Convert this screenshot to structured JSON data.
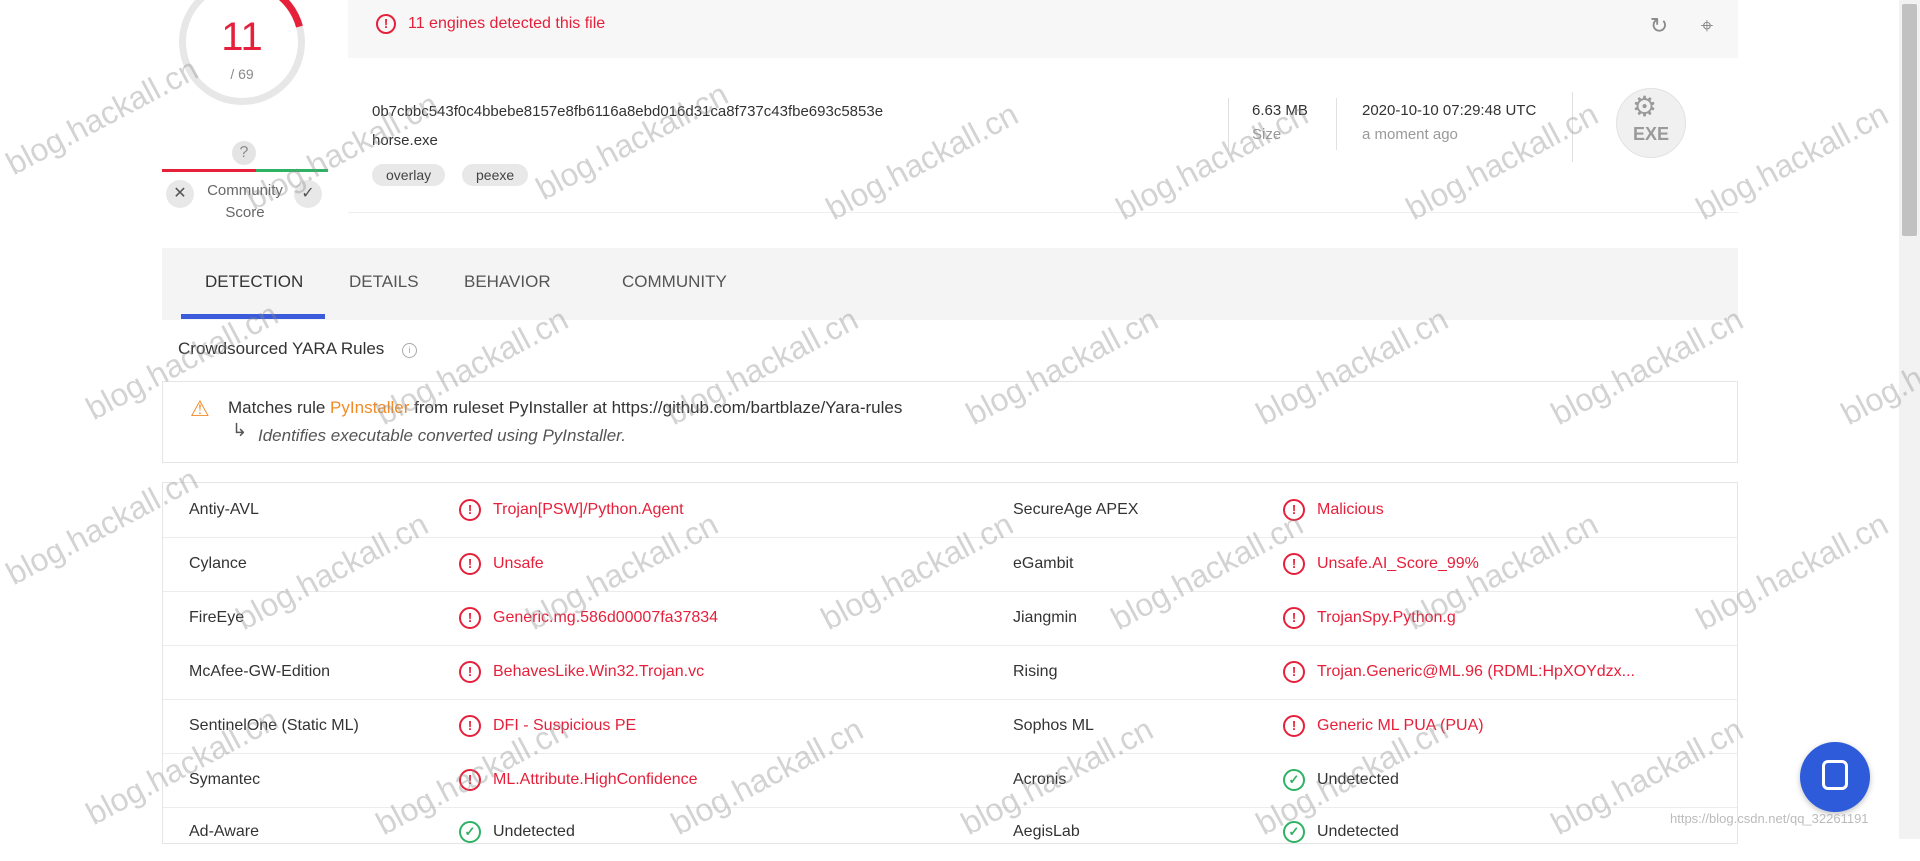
{
  "banner": {
    "text": "11 engines detected this file"
  },
  "score": {
    "detected": "11",
    "total": "/ 69",
    "unknown_badge": "?",
    "community_label": "Community Score"
  },
  "file": {
    "hash": "0b7cbbc543f0c4bbebe8157e8fb6116a8ebd016d31ca8f737c43fbe693c5853e",
    "name": "horse.exe",
    "tags": [
      "overlay",
      "peexe"
    ],
    "size_value": "6.63 MB",
    "size_label": "Size",
    "date_value": "2020-10-10 07:29:48 UTC",
    "date_label": "a moment ago",
    "type_icon_text": "EXE"
  },
  "tabs": [
    "DETECTION",
    "DETAILS",
    "BEHAVIOR",
    "COMMUNITY"
  ],
  "yara": {
    "title": "Crowdsourced YARA Rules",
    "prefix": "Matches rule ",
    "rule": "PyInstaller",
    "suffix": " from ruleset PyInstaller at https://github.com/bartblaze/Yara-rules",
    "description": "Identifies executable converted using PyInstaller."
  },
  "detections": [
    {
      "left_engine": "Antiy-AVL",
      "left_result": "Trojan[PSW]/Python.Agent",
      "left_status": "malicious",
      "right_engine": "SecureAge APEX",
      "right_result": "Malicious",
      "right_status": "malicious"
    },
    {
      "left_engine": "Cylance",
      "left_result": "Unsafe",
      "left_status": "malicious",
      "right_engine": "eGambit",
      "right_result": "Unsafe.AI_Score_99%",
      "right_status": "malicious"
    },
    {
      "left_engine": "FireEye",
      "left_result": "Generic.mg.586d00007fa37834",
      "left_status": "malicious",
      "right_engine": "Jiangmin",
      "right_result": "TrojanSpy.Python.g",
      "right_status": "malicious"
    },
    {
      "left_engine": "McAfee-GW-Edition",
      "left_result": "BehavesLike.Win32.Trojan.vc",
      "left_status": "malicious",
      "right_engine": "Rising",
      "right_result": "Trojan.Generic@ML.96 (RDML:HpXOYdzx...",
      "right_status": "malicious"
    },
    {
      "left_engine": "SentinelOne (Static ML)",
      "left_result": "DFI - Suspicious PE",
      "left_status": "malicious",
      "right_engine": "Sophos ML",
      "right_result": "Generic ML PUA (PUA)",
      "right_status": "malicious"
    },
    {
      "left_engine": "Symantec",
      "left_result": "ML.Attribute.HighConfidence",
      "left_status": "malicious",
      "right_engine": "Acronis",
      "right_result": "Undetected",
      "right_status": "clean"
    },
    {
      "left_engine": "Ad-Aware",
      "left_result": "Undetected",
      "left_status": "clean",
      "right_engine": "AegisLab",
      "right_result": "Undetected",
      "right_status": "clean"
    }
  ],
  "watermark": "blog.hackall.cn",
  "csdn_watermark": "https://blog.csdn.net/qq_32261191",
  "colors": {
    "malicious": "#e6203b",
    "clean": "#2eb264",
    "accent": "#3b5bdb",
    "rule": "#f28b28"
  }
}
